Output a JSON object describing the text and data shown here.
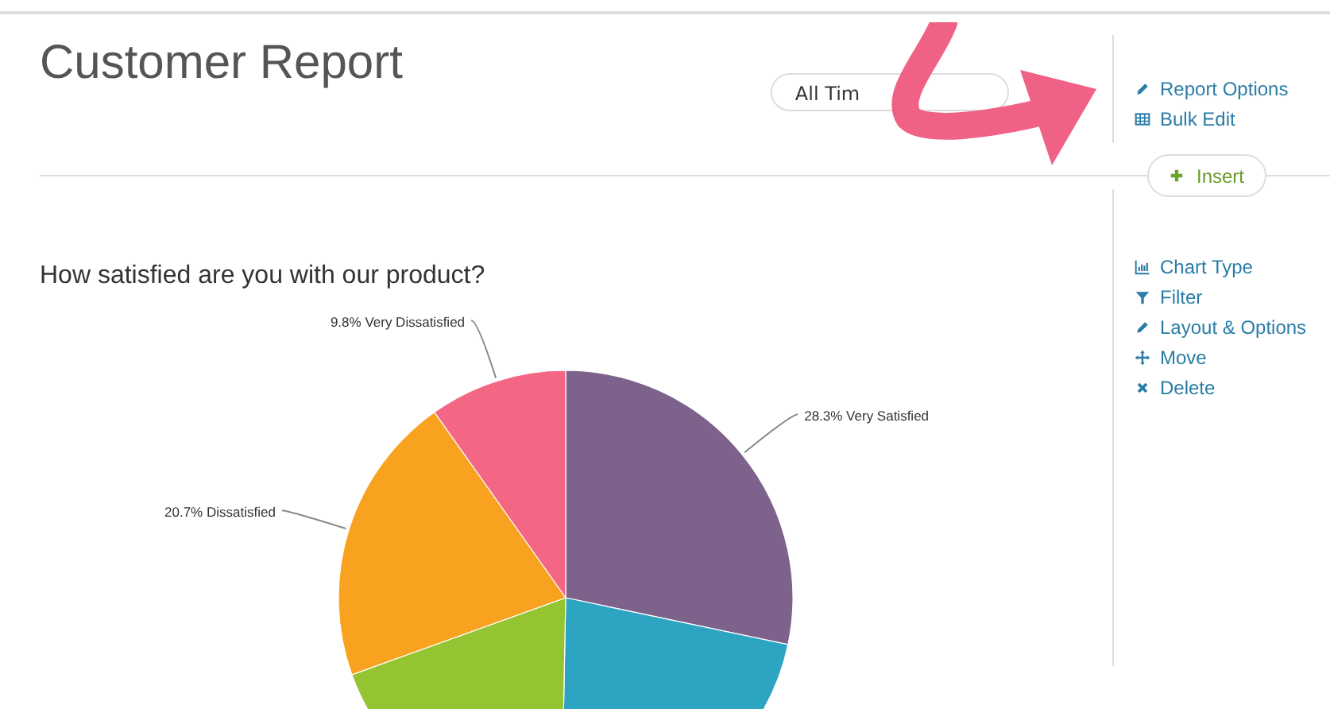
{
  "page": {
    "title": "Customer Report",
    "date_filter": {
      "value": "All Tim"
    }
  },
  "report_actions": [
    {
      "kind": "edit",
      "label": "Report Options"
    },
    {
      "kind": "grid",
      "label": "Bulk Edit"
    }
  ],
  "insert_button": {
    "label": "Insert"
  },
  "question": {
    "title": "How satisfied are you with our product?",
    "chart_data": {
      "type": "pie",
      "values": [
        28.3,
        22.0,
        19.2,
        20.7,
        9.8
      ],
      "colors": [
        "#7d628c",
        "#2ca4c2",
        "#94c431",
        "#f8a21f",
        "#f36684"
      ],
      "value_labels": [
        "28.3% Very Satisfied",
        null,
        null,
        "20.7% Dissatisfied",
        "9.8% Very Dissatisfied"
      ]
    }
  },
  "chart_actions": [
    {
      "kind": "chart",
      "label": "Chart Type"
    },
    {
      "kind": "filter",
      "label": "Filter"
    },
    {
      "kind": "edit",
      "label": "Layout & Options"
    },
    {
      "kind": "move",
      "label": "Move"
    },
    {
      "kind": "delete",
      "label": "Delete"
    }
  ]
}
